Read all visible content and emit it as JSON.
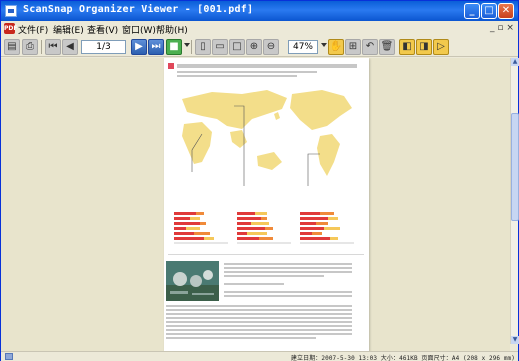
{
  "window": {
    "title": "ScanSnap Organizer Viewer - [001.pdf]",
    "controls": {
      "minimize": "_",
      "maximize": "□",
      "close": "✕"
    }
  },
  "menu": {
    "items": [
      "文件(F)",
      "编辑(E)",
      "查看(V)",
      "窗口(W)",
      "帮助(H)"
    ],
    "mdi_controls": "_ ▫ ×"
  },
  "toolbar": {
    "page_value": "1/3",
    "zoom_value": "47%"
  },
  "status": {
    "text": "建立日期：2007-5-30 13:03  大小：461KB  页面尺寸：A4 (208 x 296 mm)"
  },
  "colors": {
    "titlebar": "#0a5ed8",
    "map_land": "#f3de8a",
    "bar_red": "#e03a3a",
    "bar_orange": "#f08a3a",
    "bar_yellow": "#f5c85a"
  }
}
